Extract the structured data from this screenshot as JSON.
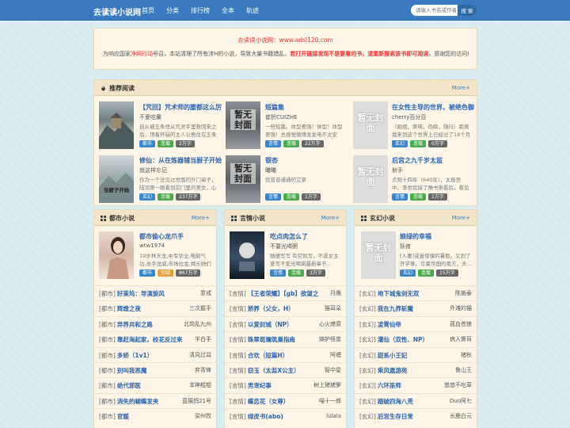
{
  "header": {
    "logo": "去读读小说网",
    "nav": [
      "首页",
      "分类",
      "排行榜",
      "全本",
      "轨迹"
    ],
    "search_placeholder": "请输入书名或作者",
    "search_btn": "搜 索"
  },
  "notice": {
    "title": "去读读小说网：www.adsl120.com",
    "text_a": "为响应国家",
    "text_hl1": "净网行动",
    "text_b": "号召，本站清理了所有涉H的小说，导致大量书籍错乱，",
    "text_hl2": "若打开链接发现不是要看的书，请重新搜索该书即可阅读",
    "text_c": "，感谢您的访问!"
  },
  "recommend": {
    "title": "推荐阅读",
    "more": "More+",
    "books": [
      {
        "title": "【咒回】咒术师的腰都这么厉",
        "author": "不爱吃羹",
        "desc": "自从被五条悟从咒灵手里救回来之后，顶着怀疑的主人公居住在五条家里…",
        "tags": [
          "都市",
          "连载",
          "2万字"
        ],
        "cover": "photo"
      },
      {
        "title": "短篇集",
        "author": "崔折CUIZHE",
        "desc": "一些短篇。体型差强！体型！体型差强！总感觉微博发发电不太安全，文字…",
        "tags": [
          "言情",
          "连载",
          "22万字"
        ],
        "cover": "dark",
        "cover_text": "暂无封面"
      },
      {
        "title": "在女性主导的世界，被绝色御",
        "author": "cherry百分百",
        "desc": "（姐姐，原味，伪娘，强行）距离我来到这个世界上已经过了18个月了…",
        "tags": [
          "玄幻",
          "连载",
          "0万字"
        ],
        "cover": "none",
        "cover_text": "暂无封面"
      },
      {
        "title": "修仙：从在炼器铺当厨子开始",
        "author": "就这样忘记",
        "desc": "作为一个没见过世面的外门弟子，陆羽第一眼看到宗门里的美女，心底里…",
        "tags": [
          "玄幻",
          "连载",
          "237万字"
        ],
        "cover": "photo2",
        "cover_text": "当厨子开始"
      },
      {
        "title": "银杏",
        "author": "曦曦",
        "desc": "就普普通通的艾草",
        "tags": [
          "言情",
          "连载",
          "1万字"
        ],
        "cover": "dark",
        "cover_text": "暂无封面"
      },
      {
        "title": "后宫之九千岁太监",
        "author": "射手",
        "desc": "贞观十四年（640年），太极宫中。李世民接了隋书来看后，看见你家族…",
        "tags": [
          "言情",
          "连载",
          "1万字"
        ],
        "cover": "none",
        "cover_text": "暂无封面"
      }
    ]
  },
  "columns": [
    {
      "title": "都市小说",
      "more": "More+",
      "featured": {
        "title": "都市偷心龙爪手",
        "author": "wtw1974",
        "desc": "19岁林天龙,中专毕业,电脑气功,坐手龙威,市场拉金,揭示她们的…",
        "tags": [
          "都市",
          "完结",
          "867万字"
        ]
      },
      "rows": [
        {
          "cat": "[都市]",
          "name": "好莱坞：导演旋风",
          "author": "意戒"
        },
        {
          "cat": "[都市]",
          "name": "辉煌之夜",
          "author": "三次握手"
        },
        {
          "cat": "[都市]",
          "name": "异界共和之路",
          "author": "北岗乱九州"
        },
        {
          "cat": "[都市]",
          "name": "靠赶海起家，校花反过来",
          "author": "半白手"
        },
        {
          "cat": "[都市]",
          "name": "多娇（1v1）",
          "author": "清风过耳"
        },
        {
          "cat": "[都市]",
          "name": "别叫我恶魔",
          "author": "弈青锋"
        },
        {
          "cat": "[都市]",
          "name": "绝代邪医",
          "author": "本神棍棍"
        },
        {
          "cat": "[都市]",
          "name": "消失的蝴蝶发夹",
          "author": "蓝猫鸽21号"
        },
        {
          "cat": "[都市]",
          "name": "官媛",
          "author": "梁州牧"
        }
      ]
    },
    {
      "title": "言情小说",
      "more": "More+",
      "featured": {
        "title": "吃点肉怎么了",
        "author": "不要光喝粥",
        "desc": "随便写写 有空就写，不虐女主 爱写不爱光喝粥最新章节…",
        "tags": [
          "言情",
          "连载",
          "3万字"
        ]
      },
      "rows": [
        {
          "cat": "[言情]",
          "name": "【王者荣耀】【gb】欲望之",
          "author": "月晚"
        },
        {
          "cat": "[言情]",
          "name": "娇养（父女，H）",
          "author": "猫耳朵"
        },
        {
          "cat": "[言情]",
          "name": "以爱封城（NP）",
          "author": "心火燎原"
        },
        {
          "cat": "[言情]",
          "name": "珠翠斑斓筑巢指南",
          "author": "嫉妒怪兽"
        },
        {
          "cat": "[言情]",
          "name": "合欢（短篇H）",
          "author": "阿缠"
        },
        {
          "cat": "[言情]",
          "name": "窃玉（太监X公主）",
          "author": "智中星"
        },
        {
          "cat": "[言情]",
          "name": "男宠纪事",
          "author": "树上猪猪箩"
        },
        {
          "cat": "[言情]",
          "name": "蝶恋花（女尊）",
          "author": "喵十一郎"
        },
        {
          "cat": "[言情]",
          "name": "绿皮书(abo)",
          "author": "lulala"
        }
      ]
    },
    {
      "title": "玄幻小说",
      "more": "More+",
      "featured": {
        "title": "娘绿的幸福",
        "author": "妖夜",
        "desc": "[人妻]或者惊悚的暑假。又到了开学季。华夏帝国的南方，天…",
        "tags": [
          "玄幻",
          "连载",
          "15万字"
        ],
        "cover_text": "暂无封面"
      },
      "rows": [
        {
          "cat": "[玄幻]",
          "name": "地下城鬼剑无双",
          "author": "陈施泰"
        },
        {
          "cat": "[玄幻]",
          "name": "我在九界斩魔",
          "author": "外滩的猫"
        },
        {
          "cat": "[玄幻]",
          "name": "凌霄仙帝",
          "author": "孤血苍狼"
        },
        {
          "cat": "[玄幻]",
          "name": "灌仙（双性、NP）",
          "author": "病入膏肓"
        },
        {
          "cat": "[玄幻]",
          "name": "甜系小王妃",
          "author": "褚秋"
        },
        {
          "cat": "[玄幻]",
          "name": "乘风遨游苑",
          "author": "鲁山王"
        },
        {
          "cat": "[玄幻]",
          "name": "六环巫师",
          "author": "悠悠不吃草"
        },
        {
          "cat": "[玄幻]",
          "name": "踏破四海八荒",
          "author": "Duo阿七"
        },
        {
          "cat": "[玄幻]",
          "name": "后宫生存日常",
          "author": "长鹿白元"
        }
      ]
    }
  ]
}
